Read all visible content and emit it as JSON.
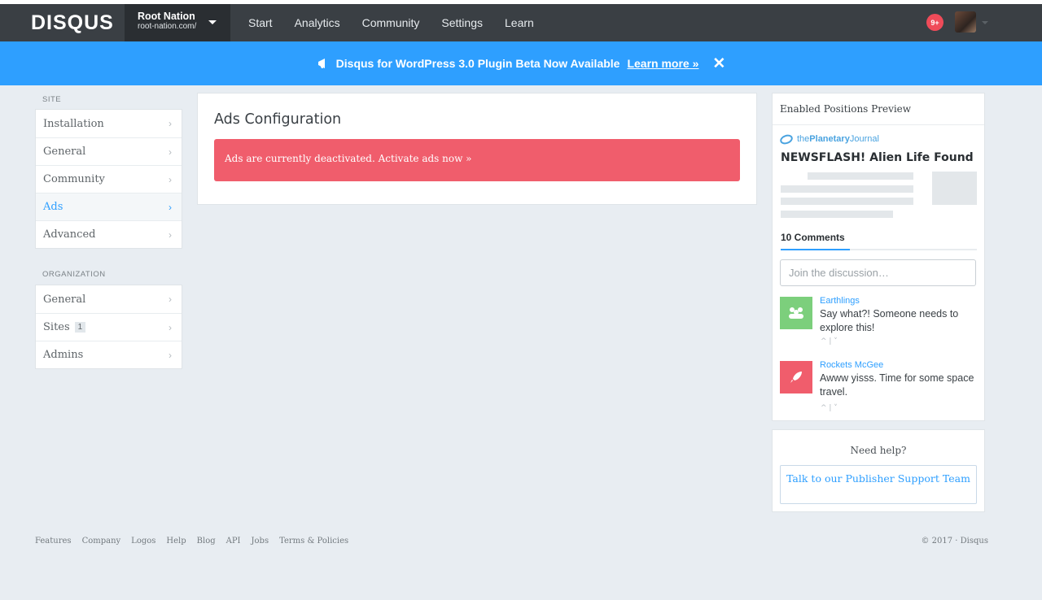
{
  "header": {
    "logo": "DISQUS",
    "site_name": "Root Nation",
    "site_url": "root-nation.com/",
    "nav": [
      "Start",
      "Analytics",
      "Community",
      "Settings",
      "Learn"
    ],
    "notifications": "9+"
  },
  "announcement": {
    "text": "Disqus for WordPress 3.0 Plugin Beta Now Available",
    "link": "Learn more »",
    "close": "✕"
  },
  "sidebar": {
    "site_heading": "SITE",
    "site_items": [
      {
        "label": "Installation"
      },
      {
        "label": "General"
      },
      {
        "label": "Community"
      },
      {
        "label": "Ads"
      },
      {
        "label": "Advanced"
      }
    ],
    "org_heading": "ORGANIZATION",
    "org_items": [
      {
        "label": "General"
      },
      {
        "label": "Sites",
        "badge": "1"
      },
      {
        "label": "Admins"
      }
    ],
    "chevron": "›"
  },
  "main": {
    "title": "Ads Configuration",
    "alert": "Ads are currently deactivated. Activate ads now »"
  },
  "preview": {
    "heading": "Enabled Positions Preview",
    "brand_prefix": "the",
    "brand_bold": "Planetary",
    "brand_suffix": "Journal",
    "headline": "NEWSFLASH! Alien Life Found",
    "comments_title": "10 Comments",
    "join_placeholder": "Join the discussion…",
    "comments": [
      {
        "author": "Earthlings",
        "text": "Say what?! Someone needs to explore this!",
        "color": "#7ccf7c"
      },
      {
        "author": "Rockets McGee",
        "text": "Awww yisss. Time for some space travel.",
        "color": "#f05d6c"
      }
    ],
    "votes": "^ | ˅"
  },
  "help": {
    "question": "Need help?",
    "button": "Talk to our Publisher Support Team"
  },
  "footer": {
    "links": [
      "Features",
      "Company",
      "Logos",
      "Help",
      "Blog",
      "API",
      "Jobs",
      "Terms & Policies"
    ],
    "copyright": "© 2017 · Disqus"
  }
}
